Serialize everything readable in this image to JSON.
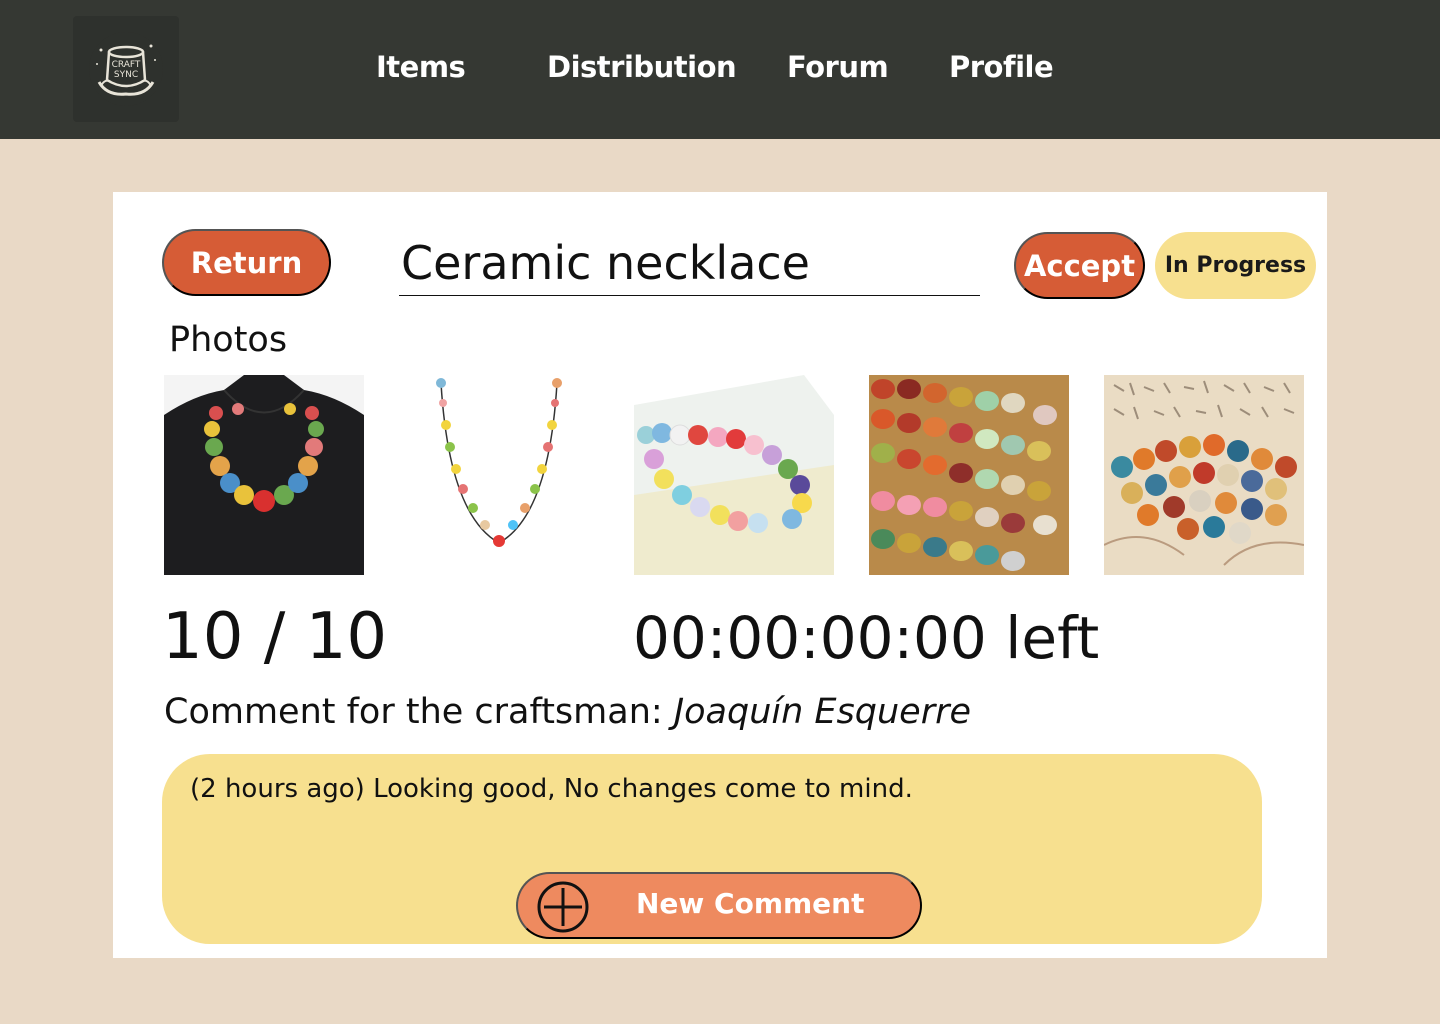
{
  "logo": {
    "text_top": "CRAFT",
    "text_bottom": "SYNC"
  },
  "nav": {
    "items": [
      {
        "label": "Items"
      },
      {
        "label": "Distribution"
      },
      {
        "label": "Forum"
      },
      {
        "label": "Profile"
      }
    ]
  },
  "item": {
    "return_label": "Return",
    "title": "Ceramic necklace",
    "accept_label": "Accept",
    "status": "In Progress",
    "photos_label": "Photos",
    "counter": "10 / 10",
    "time_left": "00:00:00:00 left"
  },
  "comments": {
    "heading_prefix": "Comment for the craftsman: ",
    "craftsman_name": "Joaquín Esquerre",
    "entries": [
      {
        "text": "(2 hours ago) Looking good, No changes come to mind."
      }
    ],
    "new_comment_label": "New Comment"
  },
  "colors": {
    "topbar": "#353833",
    "background": "#e9d9c6",
    "accent": "#d65c36",
    "status_yellow": "#f7e08f",
    "new_comment": "#ee8a5f"
  }
}
